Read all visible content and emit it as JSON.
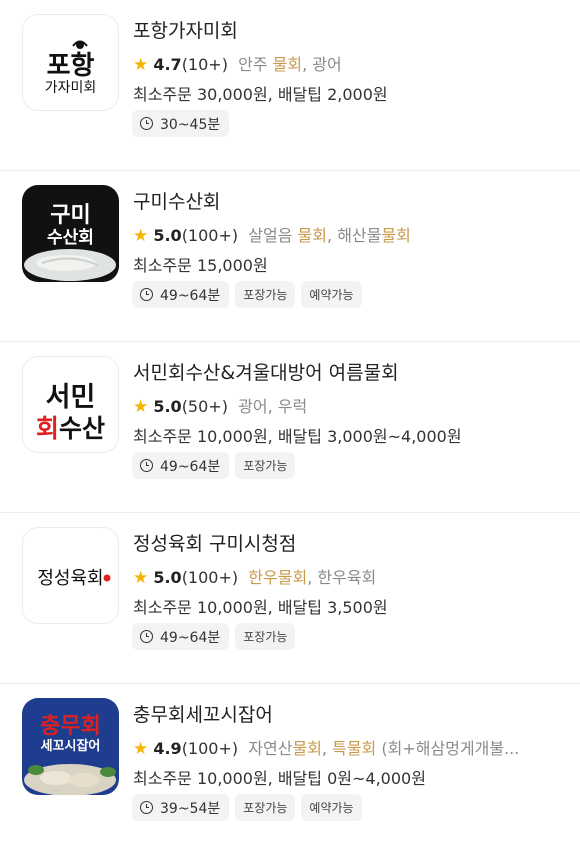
{
  "restaurants": [
    {
      "name": "포항가자미회",
      "rating": "4.7",
      "review_count": "(10+)",
      "tags": [
        {
          "text": "안주",
          "hl": false
        },
        {
          "text": "물회",
          "hl": true
        },
        {
          "text": "광어",
          "hl": false
        }
      ],
      "min_order": "최소주문 30,000원, 배달팁 2,000원",
      "delivery_time": "30~45분",
      "chips": [],
      "logo": {
        "line1": "포항",
        "line2": "가자미회",
        "bg": "#ffffff",
        "color": "#111111"
      }
    },
    {
      "name": "구미수산회",
      "rating": "5.0",
      "review_count": "(100+)",
      "tags": [
        {
          "text": "살얼음 ",
          "hl": false
        },
        {
          "text": "물회",
          "hl": true
        },
        {
          "text": "해산물",
          "hl": false
        },
        {
          "text": "물회",
          "hl": true
        }
      ],
      "min_order": "최소주문 15,000원",
      "delivery_time": "49~64분",
      "chips": [
        "포장가능",
        "예약가능"
      ],
      "logo": {
        "line1": "구미",
        "line2": "수산회",
        "bg": "#111111",
        "color": "#ffffff"
      }
    },
    {
      "name": "서민회수산&겨울대방어 여름물회",
      "rating": "5.0",
      "review_count": "(50+)",
      "tags": [
        {
          "text": "광어",
          "hl": false
        },
        {
          "text": "우럭",
          "hl": false
        }
      ],
      "min_order": "최소주문 10,000원, 배달팁 3,000원~4,000원",
      "delivery_time": "49~64분",
      "chips": [
        "포장가능"
      ],
      "logo": {
        "line1": "서민",
        "line2a": "회",
        "line2b": "수산",
        "bg": "#ffffff",
        "color": "#111111",
        "accent": "#e0201f"
      }
    },
    {
      "name": "정성육회 구미시청점",
      "rating": "5.0",
      "review_count": "(100+)",
      "tags": [
        {
          "text": "한우물회",
          "hl": true
        },
        {
          "text": "한우육회",
          "hl": false
        }
      ],
      "min_order": "최소주문 10,000원, 배달팁 3,500원",
      "delivery_time": "49~64분",
      "chips": [
        "포장가능"
      ],
      "logo": {
        "line1": "정성육회",
        "bg": "#ffffff",
        "color": "#111111",
        "accent": "#e0201f"
      }
    },
    {
      "name": "충무회세꼬시잡어",
      "rating": "4.9",
      "review_count": "(100+)",
      "tags": [
        {
          "text": "자연산",
          "hl": false
        },
        {
          "text": "물회",
          "hl": true
        },
        {
          "text": "특물회",
          "hl": true
        },
        {
          "text": "(회+해삼멍게개불...",
          "hl": false
        }
      ],
      "min_order": "최소주문 10,000원, 배달팁 0원~4,000원",
      "delivery_time": "39~54분",
      "chips": [
        "포장가능",
        "예약가능"
      ],
      "logo": {
        "line1": "충무회",
        "line2": "세꼬시잡어",
        "bg": "#1f3d8f",
        "color": "#ffffff",
        "accent": "#e0201f"
      }
    }
  ],
  "colors": {
    "star": "#f5b400",
    "highlight_tag": "#c99a4c",
    "muted_tag": "#8b8b8b"
  },
  "icons": {
    "rating": "star-icon",
    "time": "clock-icon"
  }
}
